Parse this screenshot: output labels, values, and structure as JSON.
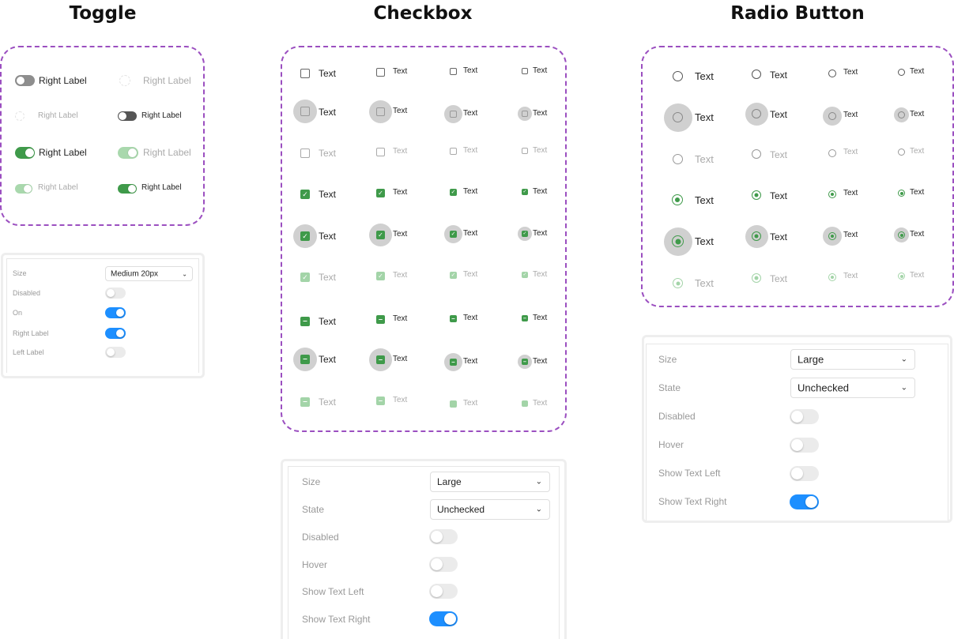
{
  "titles": {
    "toggle": "Toggle",
    "checkbox": "Checkbox",
    "radio": "Radio Button"
  },
  "colors": {
    "accent_green": "#3f9a4a",
    "switch_blue": "#1d8fff",
    "dashed_border": "#9b4fc0"
  },
  "toggle_demo": {
    "label": "Right Label"
  },
  "option_label": "Text",
  "toggle_props": {
    "size_label": "Size",
    "size_value": "Medium 20px",
    "disabled_label": "Disabled",
    "on_label": "On",
    "right_label": "Right Label",
    "left_label": "Left Label"
  },
  "checkbox_props": {
    "size_label": "Size",
    "size_value": "Large",
    "state_label": "State",
    "state_value": "Unchecked",
    "disabled_label": "Disabled",
    "hover_label": "Hover",
    "show_left_label": "Show Text Left",
    "show_right_label": "Show Text Right"
  },
  "radio_props": {
    "size_label": "Size",
    "size_value": "Large",
    "state_label": "State",
    "state_value": "Unchecked",
    "disabled_label": "Disabled",
    "hover_label": "Hover",
    "show_left_label": "Show Text Left",
    "show_right_label": "Show Text Right"
  },
  "icons": {
    "dropdown": "chevron-down-icon",
    "check": "checkmark-icon",
    "indeterminate": "minus-icon"
  }
}
